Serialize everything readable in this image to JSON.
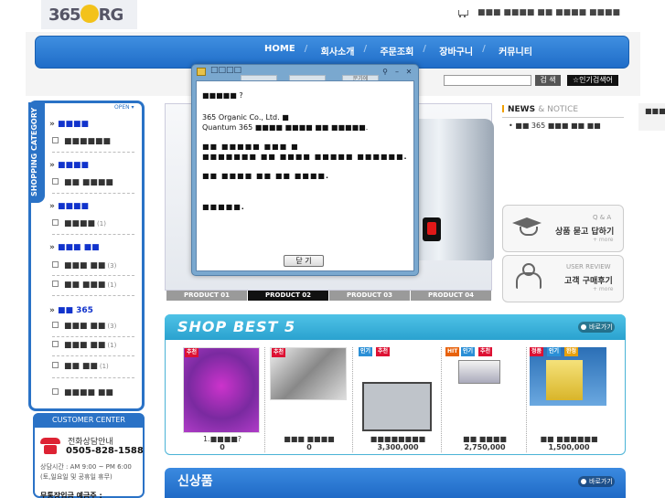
{
  "logo": {
    "text": "365 RG"
  },
  "top_links": [
    "■■■ ■■■■ ■■ ■■■■ ■■■■"
  ],
  "nav": {
    "items": [
      "HOME",
      "회사소개",
      "주문조회",
      "장바구니",
      "커뮤니티"
    ]
  },
  "search": {
    "button": "검 색",
    "popular": "☆인기검색어"
  },
  "sidebar": {
    "tab_label": "SHOPPING CATEGORY",
    "open_label": "OPEN ▾",
    "groups": [
      {
        "title": "■■■■",
        "items": [
          {
            "name": "■■■■■■",
            "count": ""
          }
        ]
      },
      {
        "title": "■■■■",
        "items": [
          {
            "name": "■■ ■■■■",
            "count": ""
          }
        ]
      },
      {
        "title": "■■■■",
        "items": [
          {
            "name": "■■■■",
            "count": "(1)"
          }
        ]
      },
      {
        "title": "■■■ ■■",
        "items": [
          {
            "name": "■■■ ■■",
            "count": "(3)"
          },
          {
            "name": "■■ ■■■",
            "count": "(1)"
          }
        ]
      },
      {
        "title": "■■ 365",
        "items": [
          {
            "name": "■■■ ■■",
            "count": "(3)"
          },
          {
            "name": "■■■ ■■",
            "count": "(1)"
          },
          {
            "name": "■■ ■■",
            "count": "(1)"
          }
        ]
      }
    ],
    "last_item": "■■■■ ■■"
  },
  "customer_center": {
    "title": "CUSTOMER CENTER",
    "label": "전화상담안내",
    "phone": "0505-828-1588",
    "hours": "상담시간 : AM 9:00 ~ PM 6:00",
    "holiday": "(토,일요일 및 공휴일 휴무)",
    "bottom": "무통장입금 예금주 :"
  },
  "product_tabs": [
    "PRODUCT 01",
    "PRODUCT 02",
    "PRODUCT 03",
    "PRODUCT 04"
  ],
  "news": {
    "title": "NEWS",
    "amp": "& NOTICE",
    "item": "■■ 365 ■■■ ■■ ■■"
  },
  "qa_box": {
    "small": "Q & A",
    "big": "상품 묻고 답하기",
    "more": "+ more"
  },
  "review_box": {
    "small": "USER REVIEW",
    "big": "고객 구매후기",
    "more": "+ more"
  },
  "right_edge": "■■■",
  "shop_best": {
    "title": "SHOP BEST 5",
    "more": "바로가기",
    "products": [
      {
        "badges": [
          "추천"
        ],
        "name": "1.■■■■?",
        "price": "0"
      },
      {
        "badges": [
          "추천"
        ],
        "name": "■■■ ■■■■",
        "price": "0"
      },
      {
        "badges": [
          "인기",
          "추천"
        ],
        "name": "■■■■■■■■",
        "price": "3,300,000"
      },
      {
        "badges": [
          "HIT",
          "인기",
          "추천"
        ],
        "name": "■■ ■■■■",
        "price": "2,750,000"
      },
      {
        "badges": [
          "정품",
          "인기",
          "한정"
        ],
        "name": "■■ ■■■■■■",
        "price": "1,500,000"
      }
    ]
  },
  "new_items": {
    "title": "신상품",
    "more": "바로가기"
  },
  "dialog": {
    "title": "□□□□",
    "ghost_tabs": [
      "",
      "",
      "문가에"
    ],
    "lines": [
      "■■■■■ ?",
      "365 Organic Co., Ltd. ■",
      "Quantum 365 ■■■■ ■■■■ ■■ ■■■■■.",
      "■■ ■■■■■ ■■■ ■",
      "■■■■■■■ ■■ ■■■■ ■■■■■ ■■■■■■.",
      "■■ ■■■■ ■■ ■■ ■■■■.",
      "■■■■■."
    ],
    "ok": "닫 기"
  },
  "colors": {
    "primary": "#2a72c6",
    "best_header": "#2aa2cf",
    "nav": "#1f6dc8"
  }
}
